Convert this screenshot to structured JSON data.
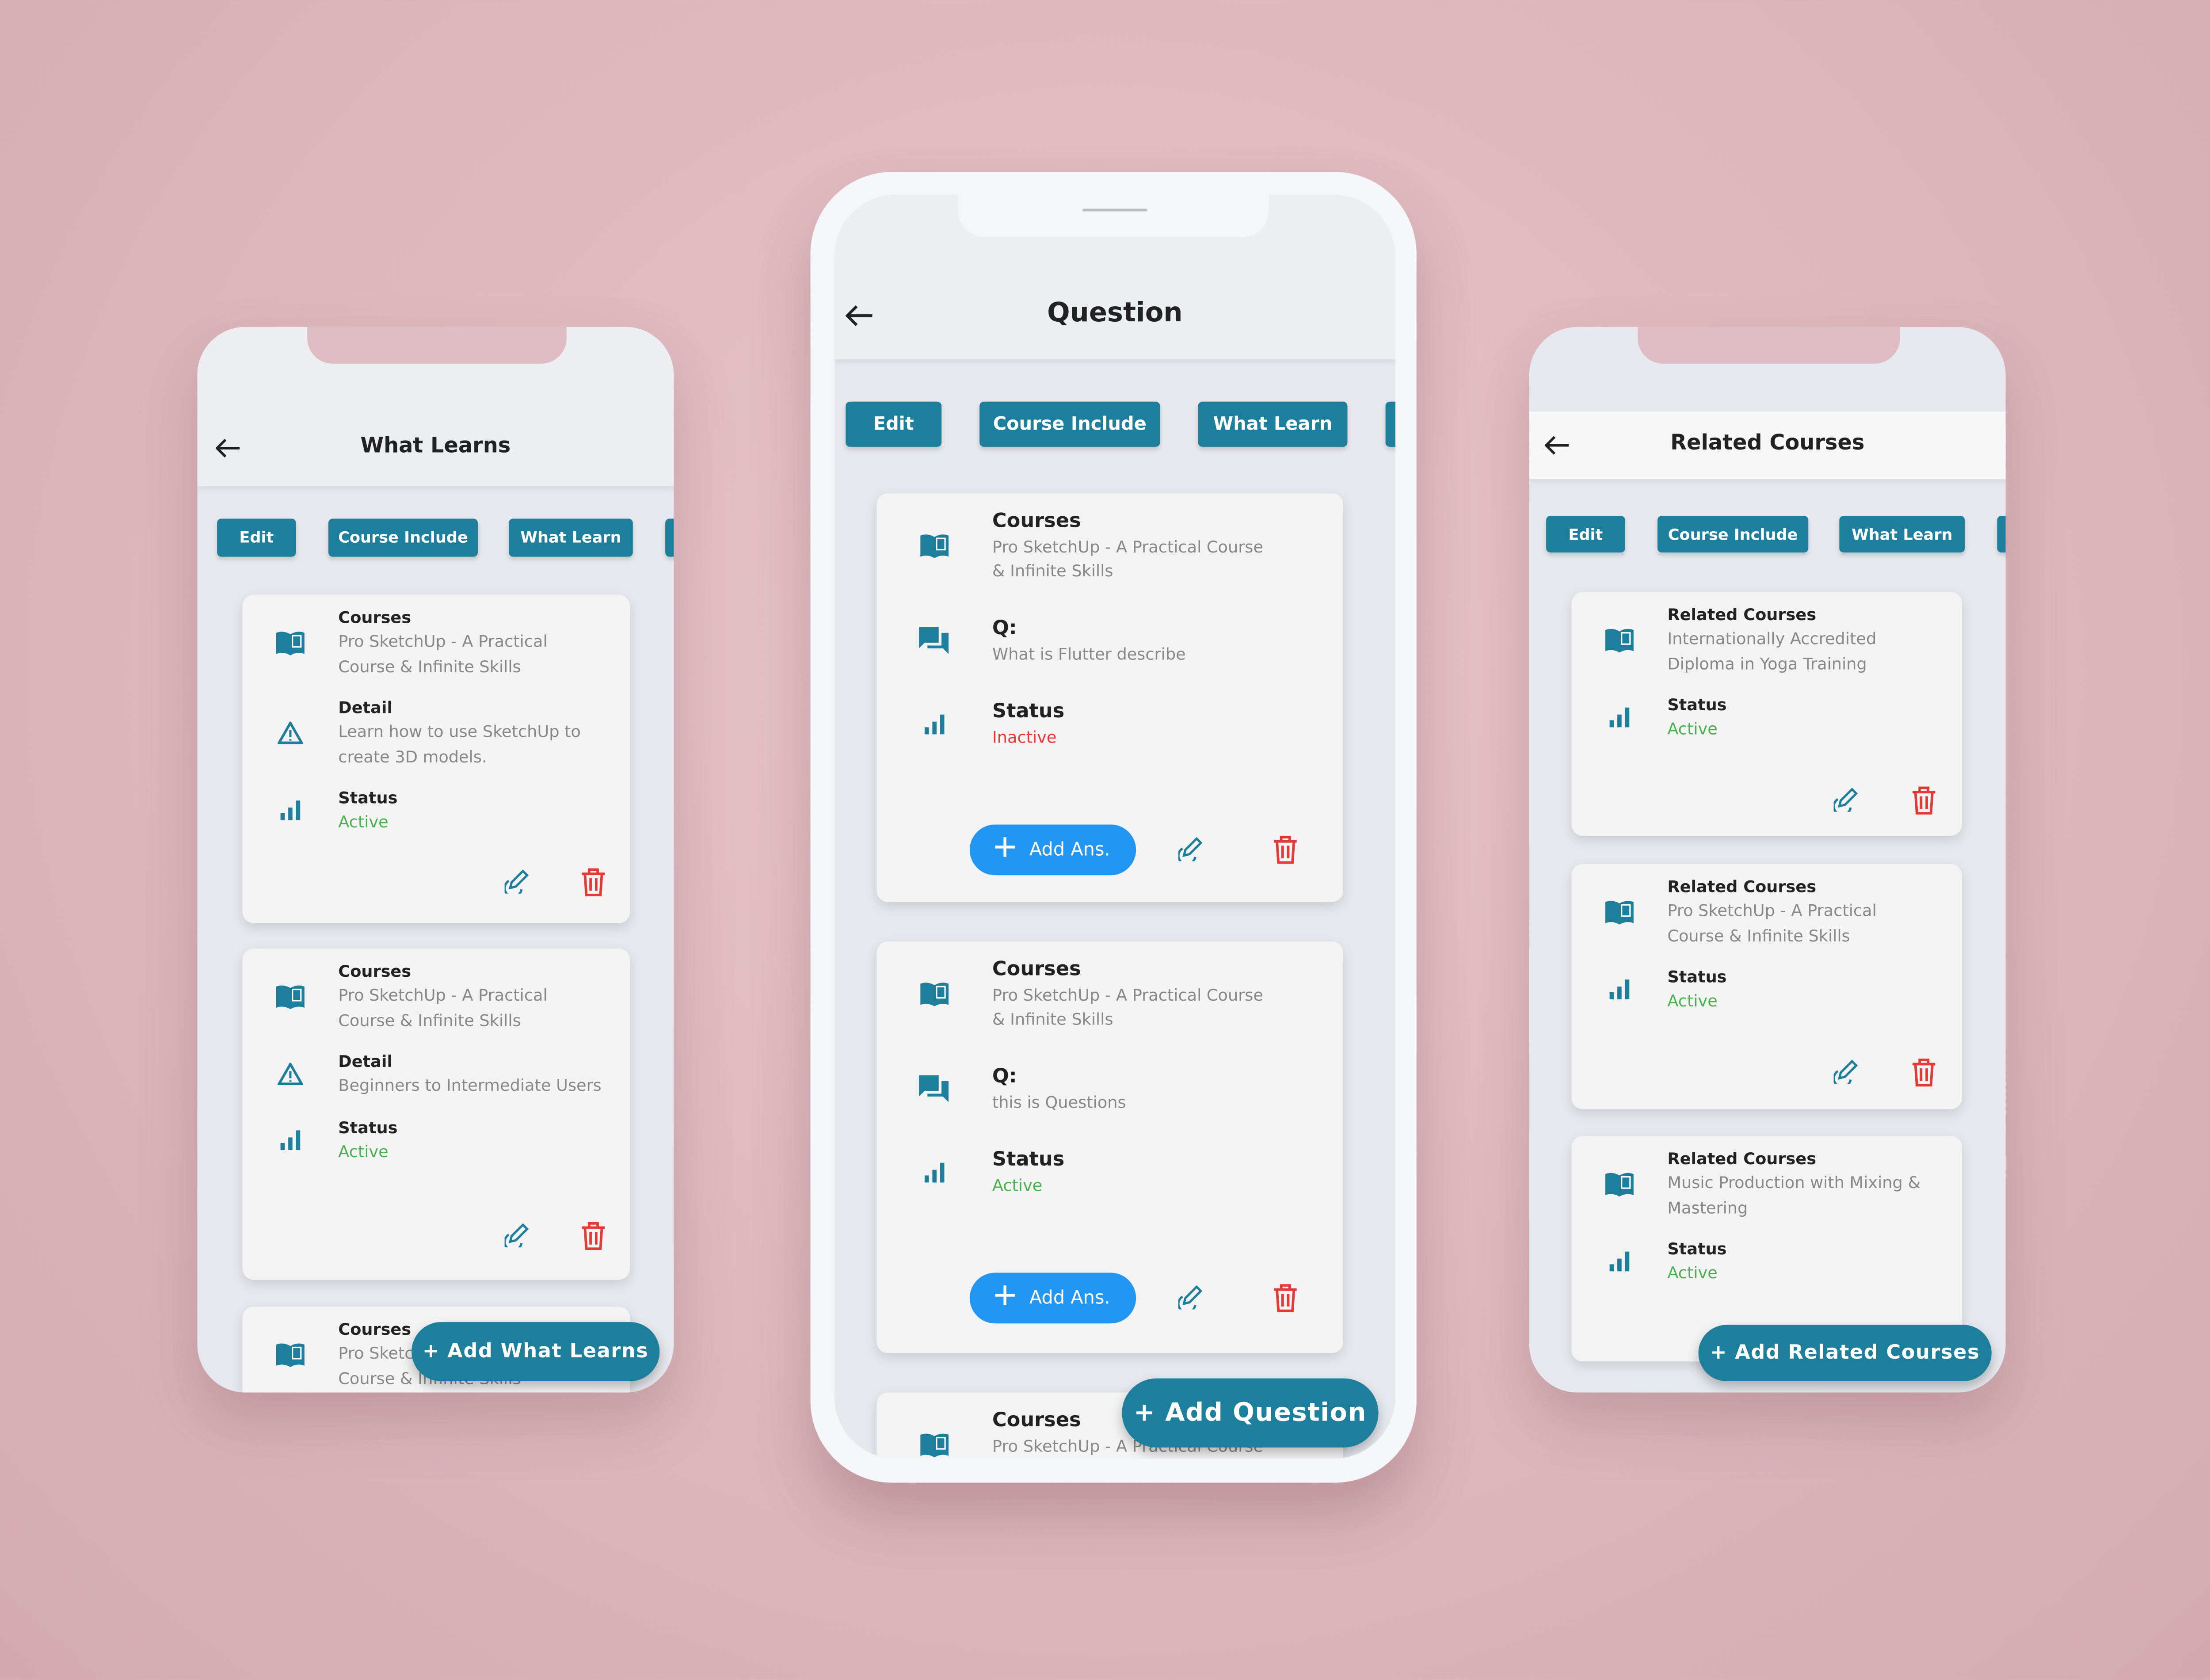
{
  "colors": {
    "primary": "#1d7f9c",
    "add_answer": "#2196f3",
    "active": "#4caf50",
    "inactive": "#e53935",
    "delete": "#e53935"
  },
  "phones": [
    {
      "title": "What Learns",
      "tabs": [
        "Edit",
        "Course Include",
        "What Learn"
      ],
      "fab": "+ Add What Learns",
      "cards": [
        {
          "rows": [
            {
              "icon": "book",
              "label": "Courses",
              "value": "Pro SketchUp - A Practical Course & Infinite Skills"
            },
            {
              "icon": "warning",
              "label": "Detail",
              "value": "Learn how to use SketchUp to create 3D models."
            },
            {
              "icon": "bar-chart",
              "label": "Status",
              "value": "Active",
              "status": "active"
            }
          ]
        },
        {
          "rows": [
            {
              "icon": "book",
              "label": "Courses",
              "value": "Pro SketchUp - A Practical Course & Infinite Skills"
            },
            {
              "icon": "warning",
              "label": "Detail",
              "value": "Beginners to Intermediate Users"
            },
            {
              "icon": "bar-chart",
              "label": "Status",
              "value": "Active",
              "status": "active"
            }
          ]
        },
        {
          "rows": [
            {
              "icon": "book",
              "label": "Courses",
              "value": "Pro SketchUp - A Practical Course & Infinite Skills"
            }
          ]
        }
      ]
    },
    {
      "title": "Question",
      "tabs": [
        "Edit",
        "Course Include",
        "What Learn"
      ],
      "fab": "+ Add Question",
      "add_answer_label": "Add Ans.",
      "cards": [
        {
          "rows": [
            {
              "icon": "book",
              "label": "Courses",
              "value": "Pro SketchUp - A Practical Course & Infinite Skills"
            },
            {
              "icon": "chat",
              "label": "Q:",
              "value": "What is Flutter describe"
            },
            {
              "icon": "bar-chart",
              "label": "Status",
              "value": "Inactive",
              "status": "inactive"
            }
          ]
        },
        {
          "rows": [
            {
              "icon": "book",
              "label": "Courses",
              "value": "Pro SketchUp - A Practical Course & Infinite Skills"
            },
            {
              "icon": "chat",
              "label": "Q:",
              "value": "this is Questions"
            },
            {
              "icon": "bar-chart",
              "label": "Status",
              "value": "Active",
              "status": "active"
            }
          ]
        },
        {
          "rows": [
            {
              "icon": "book",
              "label": "Courses",
              "value": "Pro SketchUp - A Practical Course & Infinite Skills"
            }
          ]
        }
      ]
    },
    {
      "title": "Related Courses",
      "tabs": [
        "Edit",
        "Course Include",
        "What Learn"
      ],
      "fab": "+ Add Related Courses",
      "cards": [
        {
          "rows": [
            {
              "icon": "book",
              "label": "Related Courses",
              "value": "Internationally Accredited Diploma in Yoga Training"
            },
            {
              "icon": "bar-chart",
              "label": "Status",
              "value": "Active",
              "status": "active"
            }
          ]
        },
        {
          "rows": [
            {
              "icon": "book",
              "label": "Related Courses",
              "value": "Pro SketchUp - A Practical Course & Infinite Skills"
            },
            {
              "icon": "bar-chart",
              "label": "Status",
              "value": "Active",
              "status": "active"
            }
          ]
        },
        {
          "rows": [
            {
              "icon": "book",
              "label": "Related Courses",
              "value": "Music Production with Mixing & Mastering"
            },
            {
              "icon": "bar-chart",
              "label": "Status",
              "value": "Active",
              "status": "active"
            }
          ]
        }
      ]
    }
  ]
}
